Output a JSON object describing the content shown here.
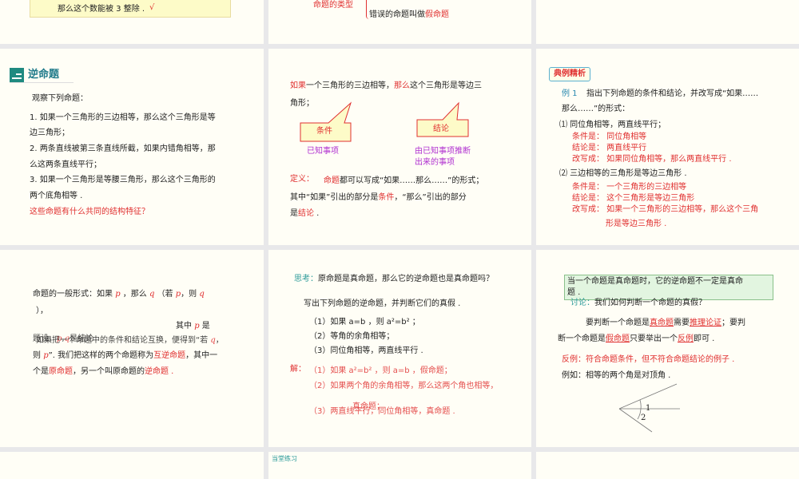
{
  "s1": {
    "line": "那么这个数能被 3 整除 .",
    "check": "√"
  },
  "s2": {
    "label": "命题的类型",
    "false_prefix": "错误的命题叫做",
    "false_term": "假命题"
  },
  "s3": {
    "title": "逆命题",
    "intro": "观察下列命题：",
    "items": [
      "1. 如果一个三角形的三边相等，那么这个三角形是等",
      "边三角形；",
      "2. 两条直线被第三条直线所截，如果内错角相等，那",
      "么这两条直线平行；",
      "3. 如果一个三角形是等腰三角形，那么这个三角形的",
      "两个底角相等 ."
    ],
    "question": "这些命题有什么共同的结构特征？"
  },
  "s4": {
    "if": "如果",
    "mid": "一个三角形的三边相等，",
    "then": "那么",
    "rest": "这个三角形是等边三",
    "line2": "角形；",
    "cond": "条件",
    "concl": "结论",
    "cond_desc": "已知事项",
    "concl_desc1": "由已知事项推断",
    "concl_desc2": "出来的事项",
    "def_label": "定义：",
    "def_term": "命题",
    "def1": "都可以写成“如果……那么……”的形式；",
    "def2a": "其中“如果”引出的部分是",
    "def2b": "条件",
    "def2c": "，“那么”引出的部分",
    "def3a": "是",
    "def3b": "结论",
    "def3c": " ."
  },
  "s5": {
    "badge": "典例精析",
    "ex": "例 1",
    "ex_text": "指出下列命题的条件和结论，并改写成“如果……",
    "ex_text2": "那么……”的形式：",
    "q1": "⑴ 同位角相等，两直线平行；",
    "a1": [
      "条件是：    同位角相等",
      "结论是：    两直线平行",
      "改写成：    如果同位角相等，那么两直线平行 ."
    ],
    "q2": "⑵ 三边相等的三角形是等边三角形 .",
    "a2": [
      "条件是：    一个三角形的三边相等",
      "结论是：    这个三角形是等边三角形",
      "改写成：    如果一个三角形的三边相等，那么这个三角",
      "形是等边三角形 ."
    ]
  },
  "s6": {
    "l1a": "命题的一般形式：如果",
    "p": "p",
    "l1b": "，那么",
    "q": "q",
    "l1c": "（若",
    "l1d": "，则",
    "l2": "），",
    "l3": "其中",
    "l3b": "是",
    "l4_over": "题设，",
    "l4_over2": "是结论",
    "l4": "如果把一个命题中的条件和结论互换，便得到“若",
    "l4e": "，",
    "l5a": "则",
    "l5b": "”. 我们把这样的两个命题称为",
    "l5c": "互逆命题",
    "l5d": "，其中一",
    "l6a": "个是",
    "l6b": "原命题",
    "l6c": "，另一个叫原命题的",
    "l6d": "逆命题",
    "l6e": " ."
  },
  "s7": {
    "think_label": "思考：",
    "think": "原命题是真命题，那么它的逆命题也是真命题吗？",
    "task": "写出下列命题的逆命题，并判断它们的真假 .",
    "items": [
      "（1）如果 a=b ，则 a²=b² ；",
      "（2）等角的余角相等；",
      "（3）同位角相等，两直线平行 ."
    ],
    "sol_label": "解：",
    "sols": [
      "（1）如果 a²=b² ，则  a=b ，假命题；",
      "（2）如果两个角的余角相等，那么这两个角也相等，",
      "真命题；",
      "（3）两直线平行，同位角相等，真命题 ."
    ]
  },
  "s8": {
    "box1": "当一个命题是真命题时，它的逆命题不一定是真命",
    "box2": "题 .",
    "disc_label": "讨论：",
    "disc": "我们如何判断一个命题的真假？",
    "p1a": "要判断一个命题是",
    "p1b": "真命题",
    "p1c": "需要",
    "p1d": "推理论证",
    "p1e": "；要判",
    "p2a": "断一个命题是",
    "p2b": "假命题",
    "p2c": "只要举出一个",
    "p2d": "反例",
    "p2e": "即可 .",
    "counter": "反例：符合命题条件，但不符合命题结论的例子 .",
    "example": "例如：相等的两个角是对顶角 .",
    "angle1": "1",
    "angle2": "2"
  },
  "s10": {
    "title": "当堂练习"
  }
}
